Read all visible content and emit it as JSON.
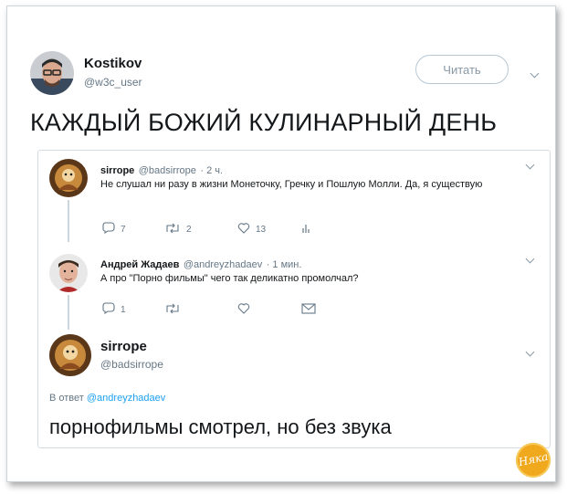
{
  "header": {
    "name": "Kostikov",
    "handle": "@w3c_user",
    "follow_label": "Читать"
  },
  "main_text": "КАЖДЫЙ БОЖИЙ КУЛИНАРНЫЙ ДЕНЬ",
  "thread": {
    "tweet1": {
      "name": "sirrope",
      "handle": "@badsirrope",
      "time": "· 2 ч.",
      "text": "Не слушал ни разу в жизни Монеточку, Гречку и Пошлую Молли. Да, я существую",
      "replies": "7",
      "retweets": "2",
      "likes": "13"
    },
    "tweet2": {
      "name": "Андрей Жадаев",
      "handle": "@andreyzhadaev",
      "time": "· 1 мин.",
      "text": "А про \"Порно фильмы\" чего так деликатно промолчал?",
      "replies": "1"
    },
    "tweet3": {
      "name": "sirrope",
      "handle": "@badsirrope",
      "reply_prefix": "В ответ",
      "reply_to": "@andreyzhadaev",
      "text": "порнофильмы смотрел, но без звука"
    }
  },
  "watermark": "Няка",
  "colors": {
    "accent": "#1da1f2",
    "muted": "#657786",
    "border": "#d6dde2",
    "badge": "#f0a81c"
  }
}
